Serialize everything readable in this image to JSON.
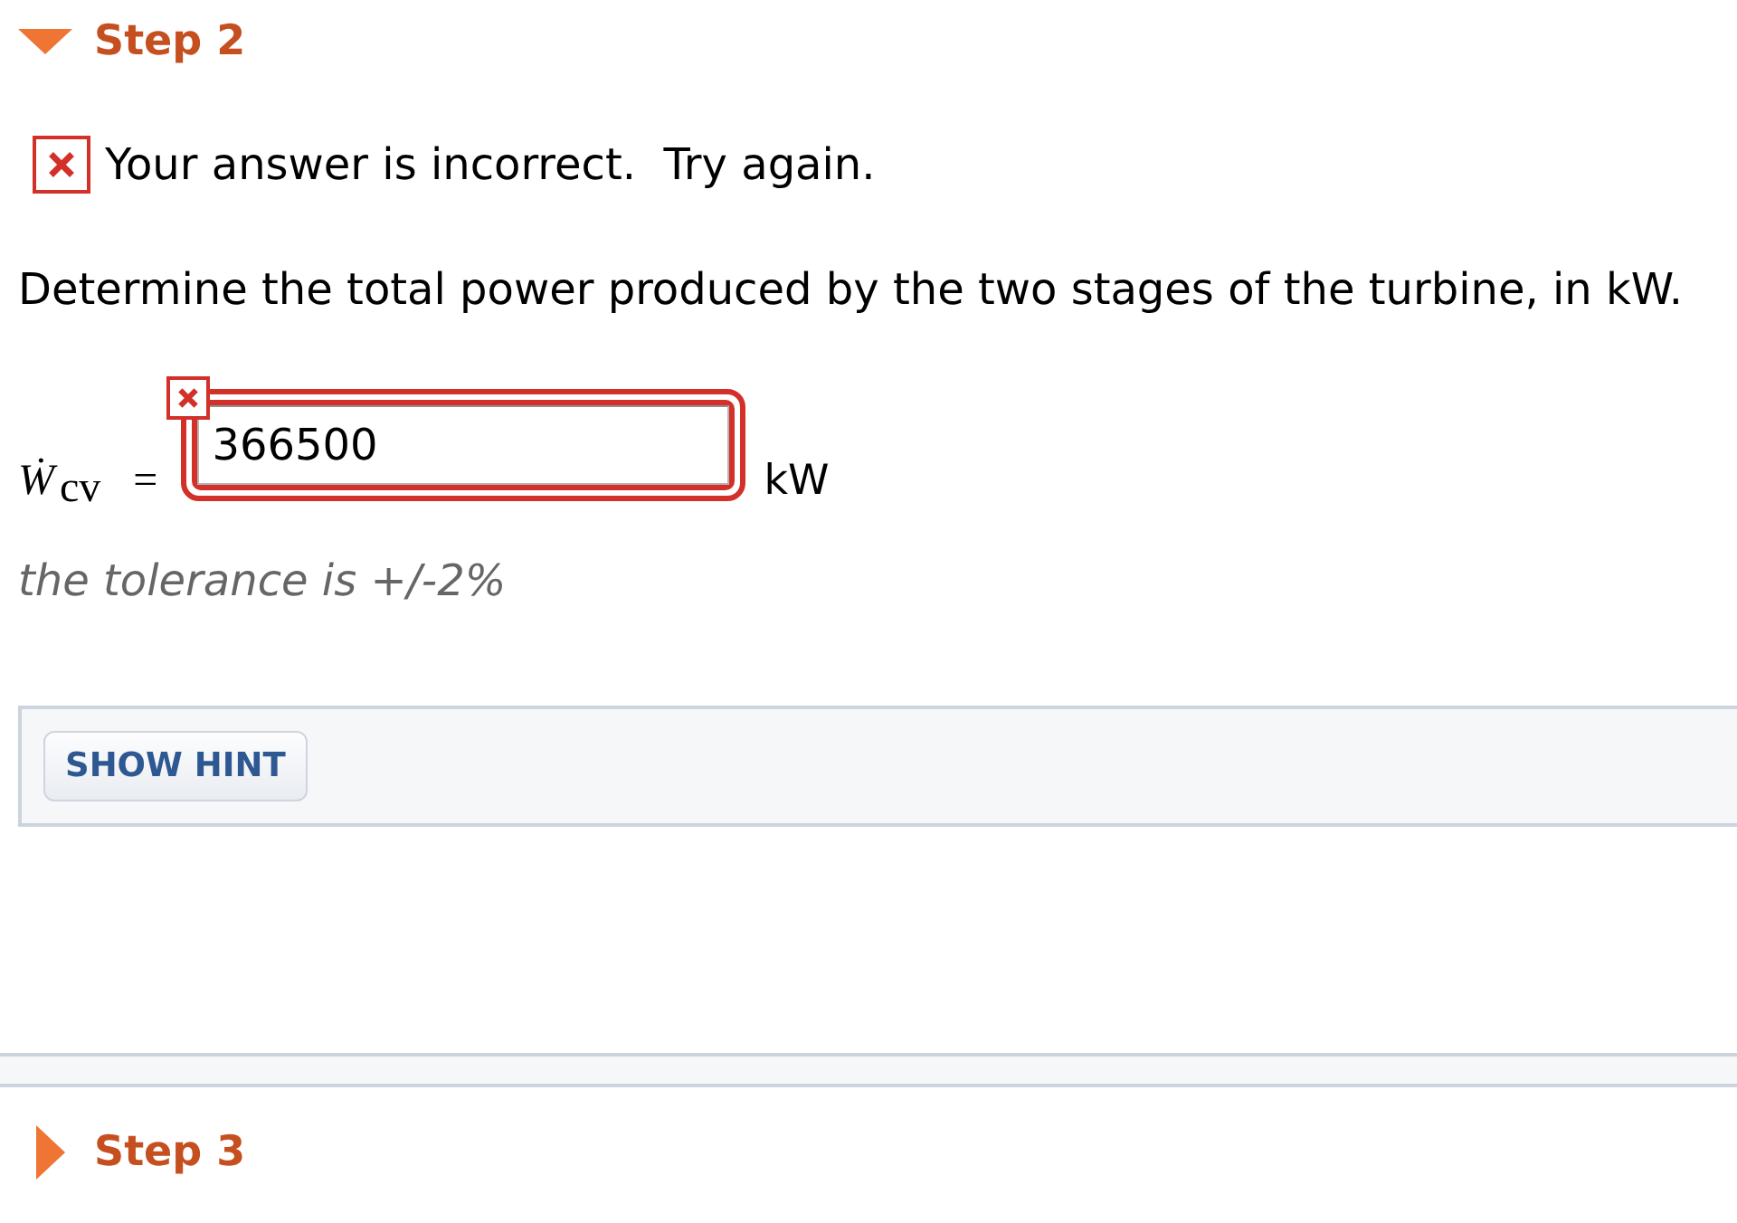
{
  "steps": [
    {
      "label": "Step 2",
      "expanded": true,
      "feedback": {
        "correct": false,
        "message": "Your answer is incorrect.  Try again."
      },
      "question": "Determine the total power produced by the two stages of the turbine, in kW.",
      "answer": {
        "expression": "*Ẇ*$_{cv}$ =",
        "value": "366500",
        "unit": "kW",
        "correct": false,
        "tolerance": "the tolerance is +/-2%"
      },
      "hint_button": "SHOW HINT"
    },
    {
      "label": "Step 3",
      "expanded": false
    }
  ]
}
